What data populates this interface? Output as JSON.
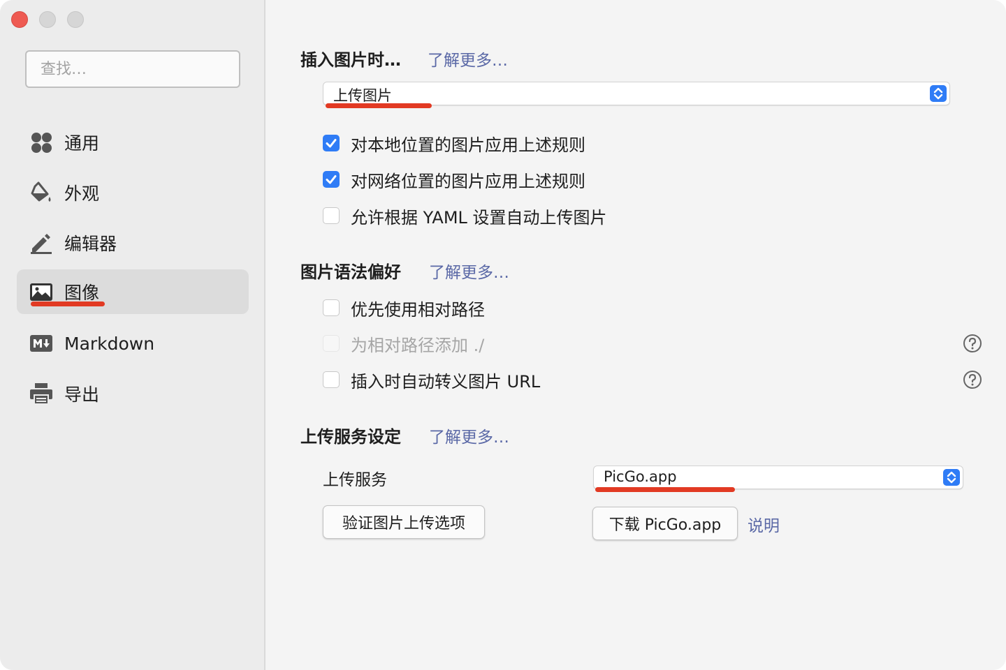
{
  "sidebar": {
    "search_placeholder": "查找…",
    "items": [
      {
        "label": "通用",
        "icon": "grid-icon"
      },
      {
        "label": "外观",
        "icon": "paint-bucket-icon"
      },
      {
        "label": "编辑器",
        "icon": "pencil-icon"
      },
      {
        "label": "图像",
        "icon": "image-icon",
        "active": true
      },
      {
        "label": "Markdown",
        "icon": "markdown-icon"
      },
      {
        "label": "导出",
        "icon": "printer-icon"
      }
    ]
  },
  "insert_section": {
    "title": "插入图片时…",
    "learn_more": "了解更多…",
    "select_value": "上传图片",
    "options": [
      {
        "label": "对本地位置的图片应用上述规则",
        "checked": true
      },
      {
        "label": "对网络位置的图片应用上述规则",
        "checked": true
      },
      {
        "label": "允许根据 YAML 设置自动上传图片",
        "checked": false
      }
    ]
  },
  "syntax_section": {
    "title": "图片语法偏好",
    "learn_more": "了解更多…",
    "options": [
      {
        "label": "优先使用相对路径",
        "checked": false,
        "disabled": false
      },
      {
        "label": "为相对路径添加 ./",
        "checked": false,
        "disabled": true
      },
      {
        "label": "插入时自动转义图片 URL",
        "checked": false,
        "disabled": false
      }
    ]
  },
  "upload_section": {
    "title": "上传服务设定",
    "learn_more": "了解更多…",
    "service_label": "上传服务",
    "service_value": "PicGo.app",
    "verify_button": "验证图片上传选项",
    "download_button": "下载 PicGo.app",
    "explain_link": "说明"
  },
  "colors": {
    "accent": "#2f7cf6",
    "link": "#5a68a6",
    "annotation_red": "#e23a23"
  }
}
